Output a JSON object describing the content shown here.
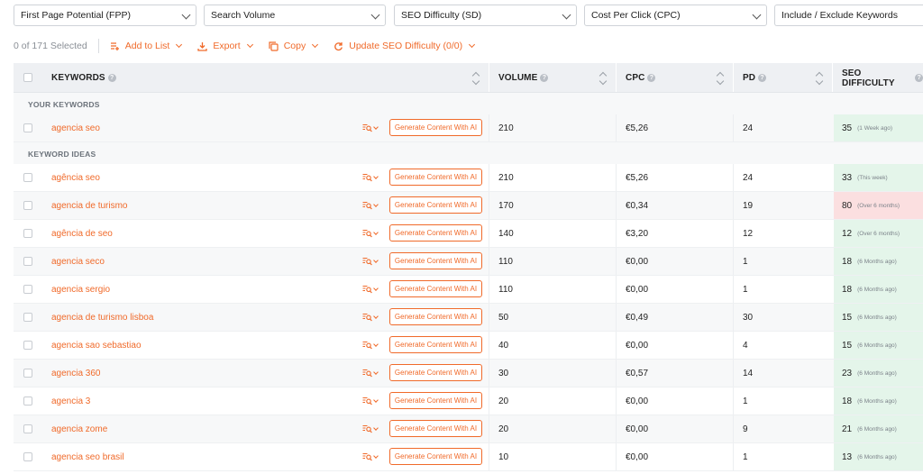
{
  "filters": [
    {
      "label": "First Page Potential (FPP)"
    },
    {
      "label": "Search Volume"
    },
    {
      "label": "SEO Difficulty (SD)"
    },
    {
      "label": "Cost Per Click (CPC)"
    },
    {
      "label": "Include / Exclude Keywords"
    }
  ],
  "actions": {
    "selected_text": "0 of 171 Selected",
    "add_to_list": "Add to List",
    "export": "Export",
    "copy": "Copy",
    "update_sd": "Update SEO Difficulty (0/0)"
  },
  "columns": {
    "keywords": "KEYWORDS",
    "volume": "VOLUME",
    "cpc": "CPC",
    "pd": "PD",
    "sd": "SEO DIFFICULTY"
  },
  "sections": {
    "your_keywords": "YOUR KEYWORDS",
    "keyword_ideas": "KEYWORD IDEAS"
  },
  "generate_label": "Generate Content With AI",
  "your_keywords": [
    {
      "keyword": "agencia seo",
      "volume": "210",
      "cpc": "€5,26",
      "pd": "24",
      "sd": "35",
      "sd_when": "(1 Week ago)",
      "sd_level": "good"
    }
  ],
  "keyword_ideas": [
    {
      "keyword": "agência seo",
      "volume": "210",
      "cpc": "€5,26",
      "pd": "24",
      "sd": "33",
      "sd_when": "(This week)",
      "sd_level": "good"
    },
    {
      "keyword": "agencia de turismo",
      "volume": "170",
      "cpc": "€0,34",
      "pd": "19",
      "sd": "80",
      "sd_when": "(Over 6 months)",
      "sd_level": "bad"
    },
    {
      "keyword": "agência de seo",
      "volume": "140",
      "cpc": "€3,20",
      "pd": "12",
      "sd": "12",
      "sd_when": "(Over 6 months)",
      "sd_level": "good"
    },
    {
      "keyword": "agencia seco",
      "volume": "110",
      "cpc": "€0,00",
      "pd": "1",
      "sd": "18",
      "sd_when": "(6 Months ago)",
      "sd_level": "good"
    },
    {
      "keyword": "agencia sergio",
      "volume": "110",
      "cpc": "€0,00",
      "pd": "1",
      "sd": "18",
      "sd_when": "(6 Months ago)",
      "sd_level": "good"
    },
    {
      "keyword": "agencia de turismo lisboa",
      "volume": "50",
      "cpc": "€0,49",
      "pd": "30",
      "sd": "15",
      "sd_when": "(6 Months ago)",
      "sd_level": "good"
    },
    {
      "keyword": "agencia sao sebastiao",
      "volume": "40",
      "cpc": "€0,00",
      "pd": "4",
      "sd": "15",
      "sd_when": "(6 Months ago)",
      "sd_level": "good"
    },
    {
      "keyword": "agencia 360",
      "volume": "30",
      "cpc": "€0,57",
      "pd": "14",
      "sd": "23",
      "sd_when": "(6 Months ago)",
      "sd_level": "good"
    },
    {
      "keyword": "agencia 3",
      "volume": "20",
      "cpc": "€0,00",
      "pd": "1",
      "sd": "18",
      "sd_when": "(6 Months ago)",
      "sd_level": "good"
    },
    {
      "keyword": "agencia zome",
      "volume": "20",
      "cpc": "€0,00",
      "pd": "9",
      "sd": "21",
      "sd_when": "(6 Months ago)",
      "sd_level": "good"
    },
    {
      "keyword": "agencia seo brasil",
      "volume": "10",
      "cpc": "€0,00",
      "pd": "1",
      "sd": "13",
      "sd_when": "(6 Months ago)",
      "sd_level": "good"
    }
  ],
  "colors": {
    "accent": "#f06a2a",
    "sd_good_bg": "#e4f5ea",
    "sd_bad_bg": "#fbdfe0",
    "header_bg": "#eef0f3"
  }
}
